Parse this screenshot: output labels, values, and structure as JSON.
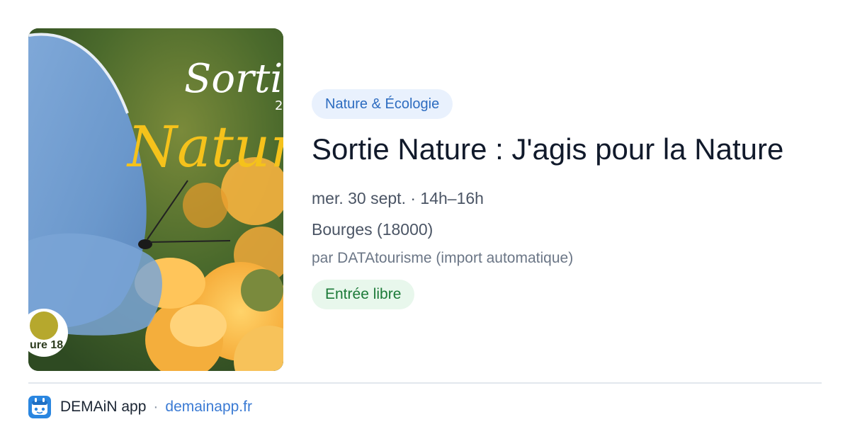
{
  "poster": {
    "image": "butterfly-on-orange-flower-photo",
    "title_script": "Sortie",
    "title_big": "Nature",
    "year_fragment": "2",
    "logo_text": "ure 18"
  },
  "event": {
    "category": "Nature & Écologie",
    "title": "Sortie Nature : J'agis pour la Nature",
    "date": "mer. 30 sept. · 14h–16h",
    "place": "Bourges (18000)",
    "organizer": "par DATAtourisme (import automatique)",
    "price": "Entrée libre"
  },
  "footer": {
    "app_icon": "demain-app-icon",
    "app_name": "DEMAiN app",
    "separator": "·",
    "url": "demainapp.fr"
  },
  "colors": {
    "category_bg": "#e9f1fd",
    "category_text": "#2d6cc0",
    "price_bg": "#e8f7ec",
    "price_text": "#1c7a38",
    "link": "#3b7bd4"
  }
}
